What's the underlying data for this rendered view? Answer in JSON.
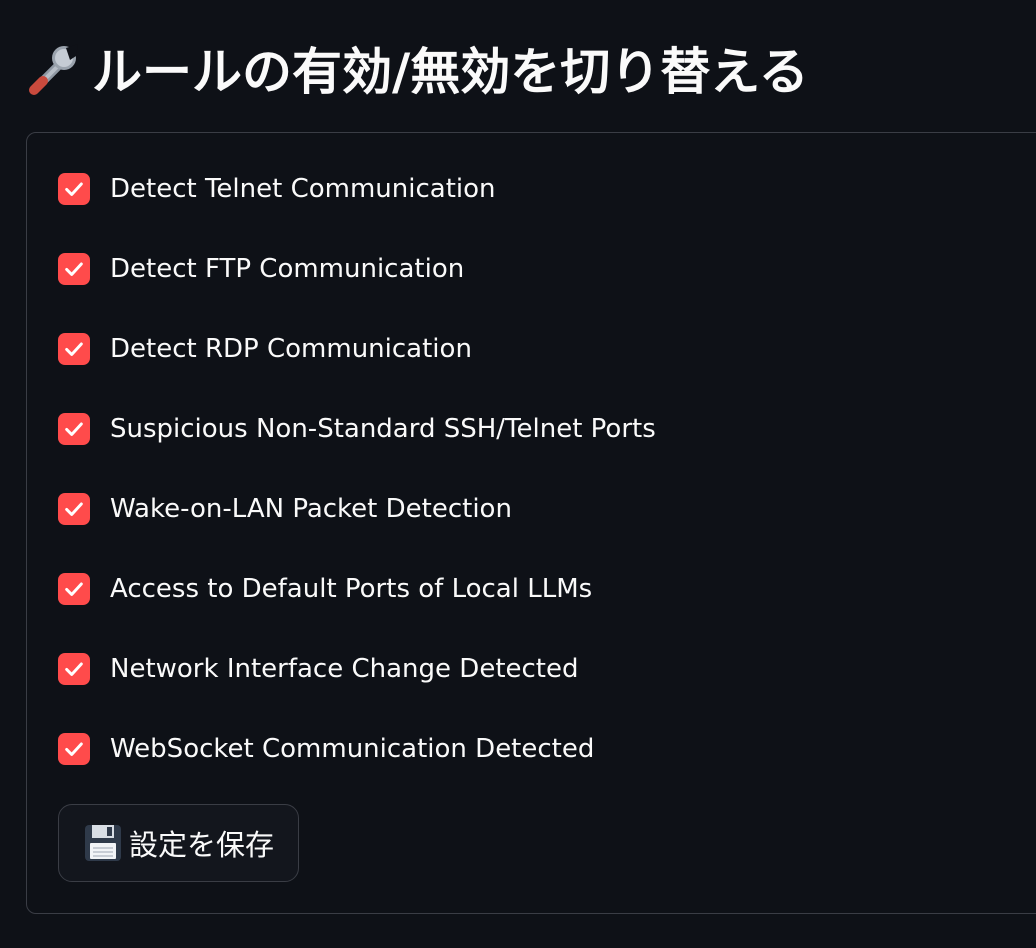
{
  "header": {
    "title": "ルールの有効/無効を切り替える",
    "icon": "wrench-icon"
  },
  "rules": [
    {
      "label": "Detect Telnet Communication",
      "checked": true
    },
    {
      "label": "Detect FTP Communication",
      "checked": true
    },
    {
      "label": "Detect RDP Communication",
      "checked": true
    },
    {
      "label": "Suspicious Non-Standard SSH/Telnet Ports",
      "checked": true
    },
    {
      "label": "Wake-on-LAN Packet Detection",
      "checked": true
    },
    {
      "label": "Access to Default Ports of Local LLMs",
      "checked": true
    },
    {
      "label": "Network Interface Change Detected",
      "checked": true
    },
    {
      "label": "WebSocket Communication Detected",
      "checked": true
    }
  ],
  "save_button": {
    "label": "設定を保存",
    "icon": "floppy-disk-icon"
  },
  "colors": {
    "background": "#0e1117",
    "accent": "#ff4b4b",
    "text": "#fafafa",
    "border": "#3a3d45"
  }
}
